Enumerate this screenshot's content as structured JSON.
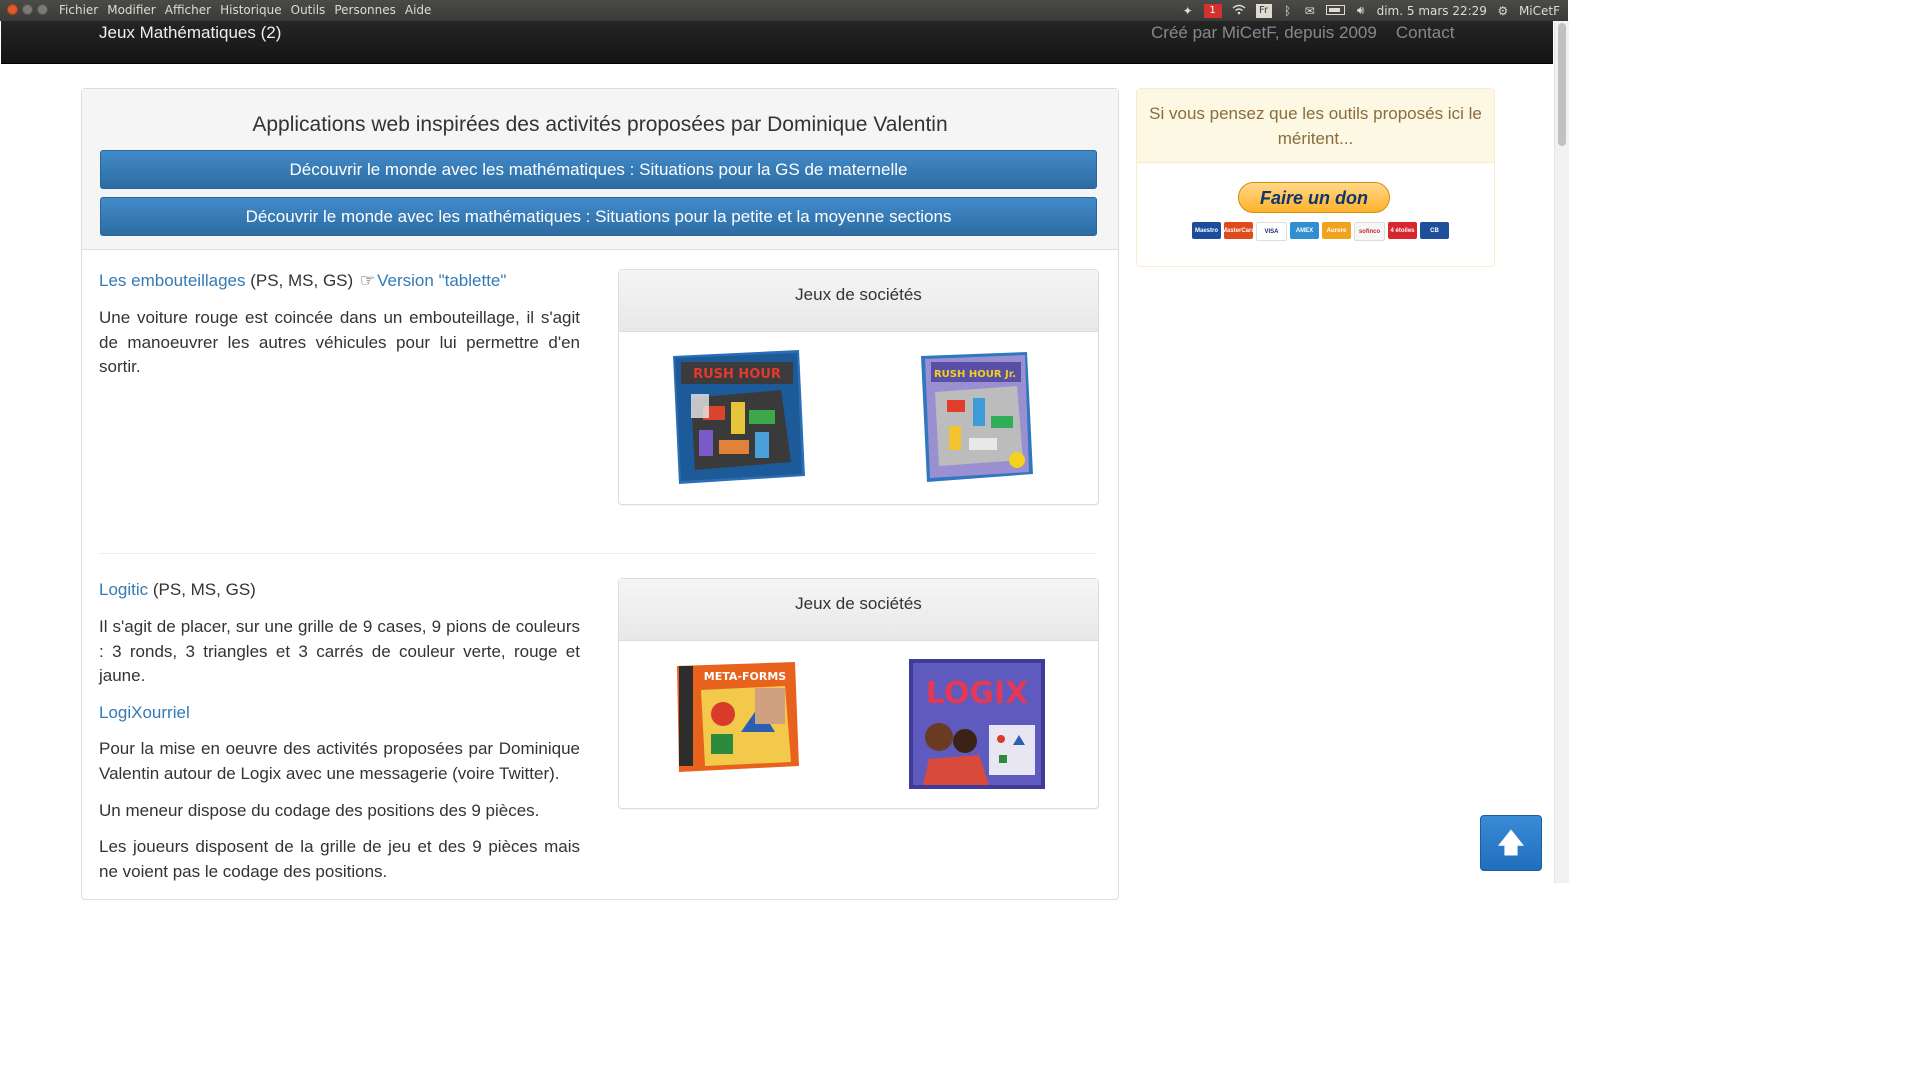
{
  "system_menu": {
    "items": [
      "Fichier",
      "Modifier",
      "Afficher",
      "Historique",
      "Outils",
      "Personnes",
      "Aide"
    ],
    "tray": {
      "notification_count": "1",
      "keyboard": "Fr",
      "datetime": "dim. 5 mars 22:29",
      "user": "MiCetF"
    }
  },
  "navbar": {
    "brand": "Jeux Mathématiques (2)",
    "created_by": "Créé par MiCetF, depuis 2009",
    "contact": "Contact"
  },
  "main": {
    "title": "Applications web inspirées des activités proposées par Dominique Valentin",
    "button1": "Découvrir le monde avec les mathématiques : Situations pour la GS de maternelle",
    "button2": "Découvrir le monde avec les mathématiques : Situations pour la petite et la moyenne sections",
    "activity1": {
      "link": "Les embouteillages",
      "levels": " (PS, MS, GS) ",
      "tablet_link": "Version \"tablette\"",
      "description": "Une voiture rouge est coincée dans un embouteillage, il s'agit de manoeuvrer les autres véhicules pour lui permettre d'en sortir.",
      "games_title": "Jeux de sociétés",
      "game_a": "RUSH HOUR",
      "game_b": "RUSH HOUR Jr."
    },
    "activity2": {
      "link": "Logitic",
      "levels": " (PS, MS, GS)",
      "description": "Il s'agit de placer, sur une grille de 9 cases, 9 pions de couleurs : 3 ronds, 3 triangles et 3 carrés de couleur verte, rouge et jaune.",
      "sub_link": "LogiXourriel",
      "para1": "Pour la mise en oeuvre des activités proposées par Dominique Valentin autour de Logix avec une messagerie (voire Twitter).",
      "para2": "Un meneur dispose du codage des positions des 9 pièces.",
      "para3": "Les joueurs disposent de la grille de jeu et des 9 pièces mais ne voient pas le codage des positions.",
      "games_title": "Jeux de sociétés",
      "game_a": "META-FORMS",
      "game_b": "LOGIX"
    }
  },
  "sidebar": {
    "message": "Si vous pensez que les outils proposés ici le méritent...",
    "donate": "Faire un don",
    "cards": [
      "Maestro",
      "MasterCard",
      "VISA",
      "AMEX",
      "Aurore",
      "sofinco",
      "4 étoiles",
      "CB"
    ]
  },
  "back_to_top_icon": "arrow-up-icon"
}
